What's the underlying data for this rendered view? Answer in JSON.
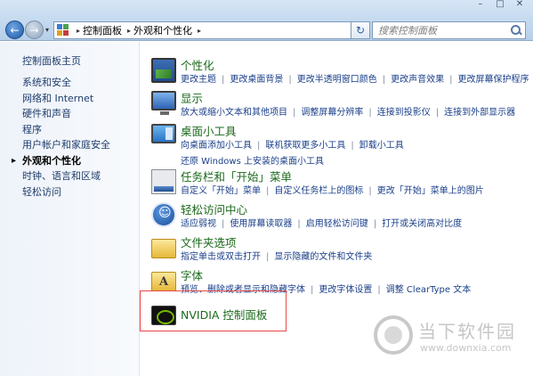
{
  "address": {
    "crumbs": [
      "控制面板",
      "外观和个性化"
    ],
    "search_placeholder": "搜索控制面板"
  },
  "sidebar": {
    "home": "控制面板主页",
    "items": [
      {
        "label": "系统和安全"
      },
      {
        "label": "网络和 Internet"
      },
      {
        "label": "硬件和声音"
      },
      {
        "label": "程序"
      },
      {
        "label": "用户帐户和家庭安全"
      },
      {
        "label": "外观和个性化",
        "current": true
      },
      {
        "label": "时钟、语言和区域"
      },
      {
        "label": "轻松访问"
      }
    ]
  },
  "categories": [
    {
      "title": "个性化",
      "icon": "personalization-icon",
      "lines": [
        [
          "更改主题",
          "更改桌面背景",
          "更改半透明窗口颜色",
          "更改声音效果",
          "更改屏幕保护程序"
        ]
      ]
    },
    {
      "title": "显示",
      "icon": "display-icon",
      "lines": [
        [
          "放大或缩小文本和其他项目",
          "调整屏幕分辨率",
          "连接到投影仪",
          "连接到外部显示器"
        ]
      ]
    },
    {
      "title": "桌面小工具",
      "icon": "gadgets-icon",
      "lines": [
        [
          "向桌面添加小工具",
          "联机获取更多小工具",
          "卸载小工具"
        ],
        [
          "还原 Windows 上安装的桌面小工具"
        ]
      ]
    },
    {
      "title": "任务栏和「开始」菜单",
      "icon": "taskbar-icon",
      "lines": [
        [
          "自定义「开始」菜单",
          "自定义任务栏上的图标",
          "更改「开始」菜单上的图片"
        ]
      ]
    },
    {
      "title": "轻松访问中心",
      "icon": "ease-of-access-icon",
      "lines": [
        [
          "适应弱视",
          "使用屏幕读取器",
          "启用轻松访问键",
          "打开或关闭高对比度"
        ]
      ]
    },
    {
      "title": "文件夹选项",
      "icon": "folder-options-icon",
      "lines": [
        [
          "指定单击或双击打开",
          "显示隐藏的文件和文件夹"
        ]
      ]
    },
    {
      "title": "字体",
      "icon": "fonts-icon",
      "lines": [
        [
          "预览、删除或者显示和隐藏字体",
          "更改字体设置",
          "调整 ClearType 文本"
        ]
      ]
    },
    {
      "title": "NVIDIA 控制面板",
      "icon": "nvidia-icon",
      "lines": []
    }
  ],
  "watermark": {
    "brand": "当下软件园",
    "url": "www.downxia.com"
  },
  "colors": {
    "category_title": "#1c6a1c",
    "link": "#1a3f8a",
    "highlight_border": "#e64848"
  }
}
